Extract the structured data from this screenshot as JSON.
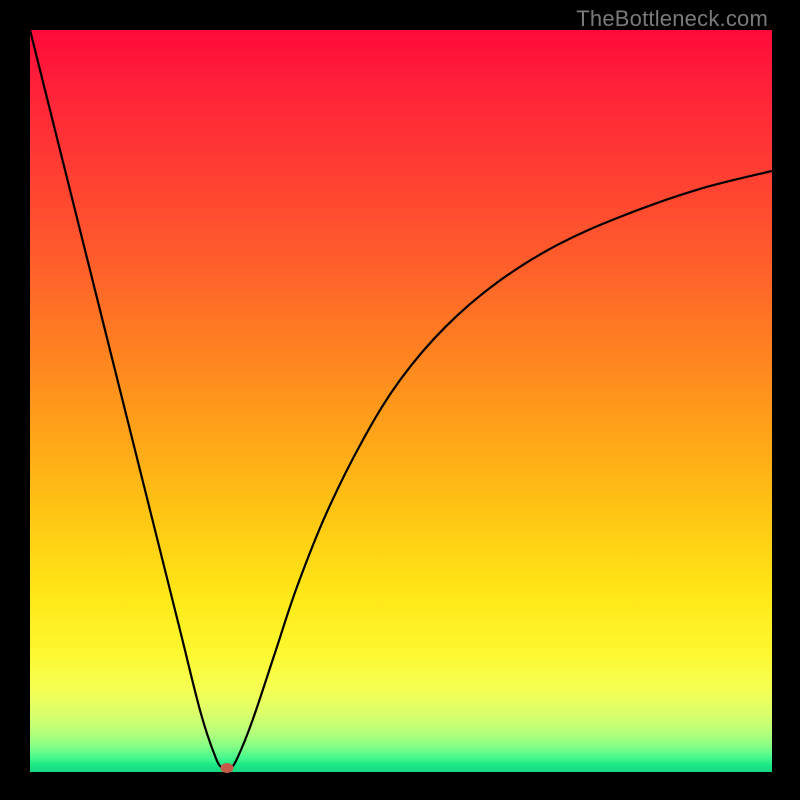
{
  "watermark": "TheBottleneck.com",
  "chart_data": {
    "type": "line",
    "title": "",
    "xlabel": "",
    "ylabel": "",
    "xlim": [
      0,
      100
    ],
    "ylim": [
      0,
      100
    ],
    "grid": false,
    "legend": false,
    "series": [
      {
        "name": "bottleneck-curve",
        "x": [
          0,
          5,
          10,
          15,
          20,
          23,
          25,
          26,
          27,
          28,
          30,
          33,
          36,
          40,
          45,
          50,
          56,
          63,
          71,
          80,
          90,
          100
        ],
        "y": [
          100,
          80,
          60,
          40,
          20,
          8,
          2,
          0.5,
          0.5,
          2,
          7,
          16,
          25,
          35,
          45,
          53,
          60,
          66,
          71,
          75,
          78.5,
          81
        ]
      }
    ],
    "marker": {
      "x": 26.5,
      "y": 0.6,
      "color": "#c85a4a"
    },
    "gradient_stops": [
      {
        "pos": 0,
        "color": "#ff0a3a"
      },
      {
        "pos": 0.45,
        "color": "#ff8a1f"
      },
      {
        "pos": 0.8,
        "color": "#ffe717"
      },
      {
        "pos": 1.0,
        "color": "#16d780"
      }
    ]
  }
}
